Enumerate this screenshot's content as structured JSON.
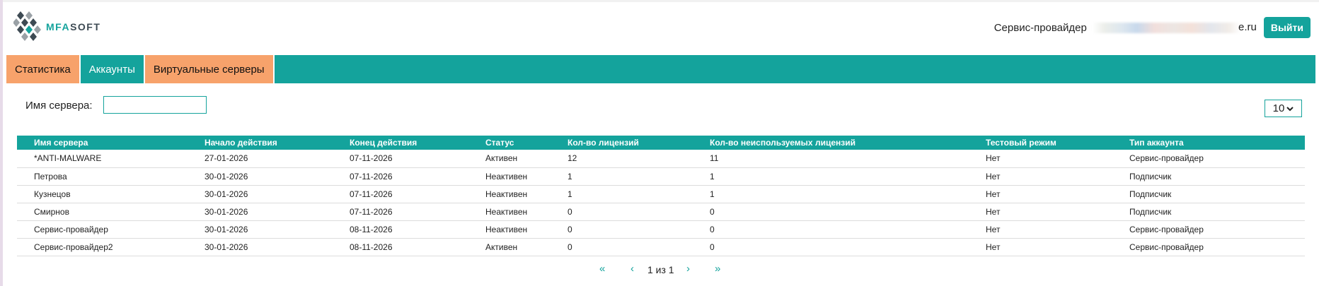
{
  "header": {
    "logo_text_accent": "MFA",
    "logo_text_rest": "SOFT",
    "provider_label": "Сервис-провайдер",
    "provider_email_visible": "e.ru",
    "logout_label": "Выйти"
  },
  "nav": {
    "tabs": [
      {
        "label": "Статистика",
        "active": false
      },
      {
        "label": "Аккаунты",
        "active": true
      },
      {
        "label": "Виртуальные серверы",
        "active": false
      }
    ]
  },
  "filter": {
    "server_name_label": "Имя сервера:",
    "server_name_value": "",
    "page_size": "10"
  },
  "table": {
    "columns": [
      "Имя сервера",
      "Начало действия",
      "Конец действия",
      "Статус",
      "Кол-во лицензий",
      "Кол-во неиспользуемых лицензий",
      "Тестовый режим",
      "Тип аккаунта"
    ],
    "rows": [
      [
        "*ANTI-MALWARE",
        "27-01-2026",
        "07-11-2026",
        "Активен",
        "12",
        "11",
        "Нет",
        "Сервис-провайдер"
      ],
      [
        "Петрова",
        "30-01-2026",
        "07-11-2026",
        "Неактивен",
        "1",
        "1",
        "Нет",
        "Подписчик"
      ],
      [
        "Кузнецов",
        "30-01-2026",
        "07-11-2026",
        "Неактивен",
        "1",
        "1",
        "Нет",
        "Подписчик"
      ],
      [
        "Смирнов",
        "30-01-2026",
        "07-11-2026",
        "Неактивен",
        "0",
        "0",
        "Нет",
        "Подписчик"
      ],
      [
        "Сервис-провайдер",
        "30-01-2026",
        "08-11-2026",
        "Неактивен",
        "0",
        "0",
        "Нет",
        "Сервис-провайдер"
      ],
      [
        "Сервис-провайдер2",
        "30-01-2026",
        "08-11-2026",
        "Активен",
        "0",
        "0",
        "Нет",
        "Сервис-провайдер"
      ]
    ]
  },
  "pagination": {
    "first": "«",
    "prev": "‹",
    "info": "1 из 1",
    "next": "›",
    "last": "»"
  },
  "colors": {
    "accent": "#14a39c",
    "tab_inactive": "#f7a26b",
    "logo_dark": "#3d4a53"
  }
}
